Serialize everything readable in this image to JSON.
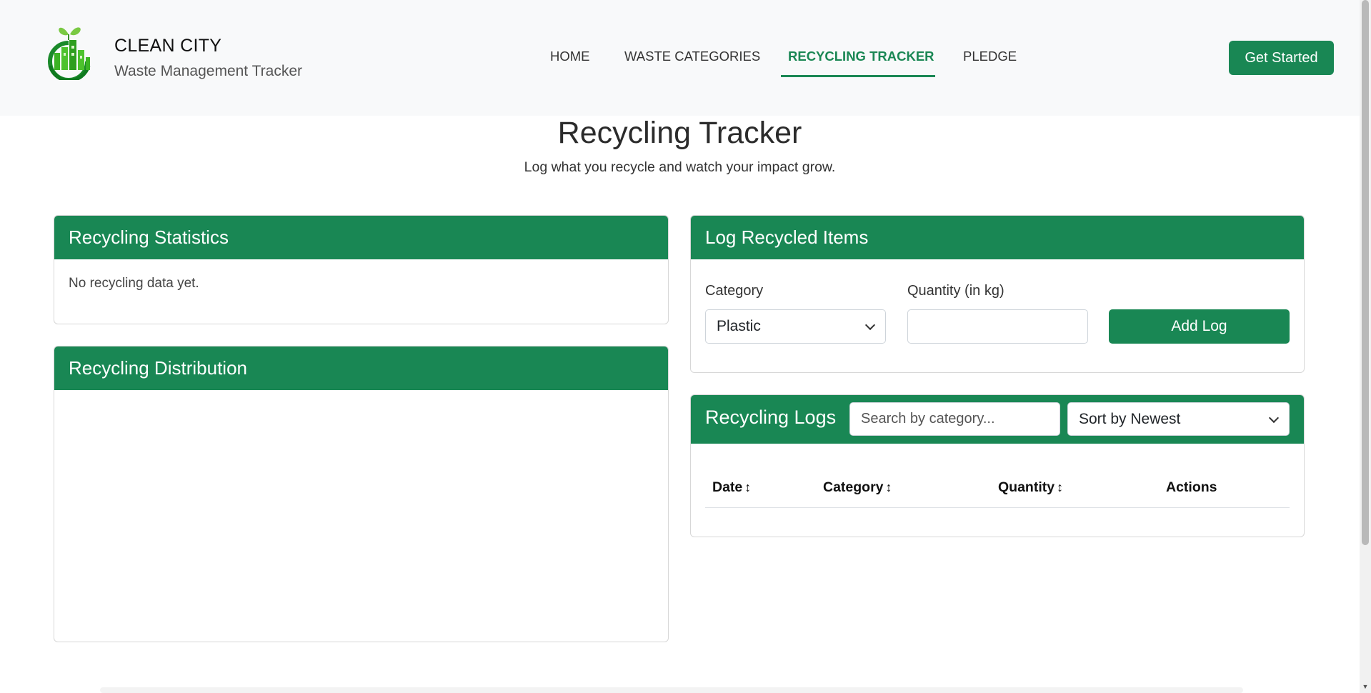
{
  "brand": {
    "name": "CLEAN CITY",
    "tagline": "Waste Management Tracker"
  },
  "nav": {
    "items": [
      {
        "label": "HOME",
        "active": false
      },
      {
        "label": "WASTE CATEGORIES",
        "active": false
      },
      {
        "label": "RECYCLING TRACKER",
        "active": true
      },
      {
        "label": "PLEDGE",
        "active": false
      }
    ],
    "cta_label": "Get Started"
  },
  "page": {
    "title": "Recycling Tracker",
    "subtitle": "Log what you recycle and watch your impact grow."
  },
  "stats": {
    "title": "Recycling Statistics",
    "empty_text": "No recycling data yet."
  },
  "distribution": {
    "title": "Recycling Distribution"
  },
  "log_form": {
    "title": "Log Recycled Items",
    "category_label": "Category",
    "category_value": "Plastic",
    "quantity_label": "Quantity (in kg)",
    "quantity_value": "",
    "submit_label": "Add Log"
  },
  "logs": {
    "title": "Recycling Logs",
    "search_placeholder": "Search by category...",
    "sort_value": "Sort by Newest",
    "columns": [
      {
        "label": "Date",
        "sortable": true
      },
      {
        "label": "Category",
        "sortable": true
      },
      {
        "label": "Quantity",
        "sortable": true
      },
      {
        "label": "Actions",
        "sortable": false
      }
    ],
    "sort_glyph": "↕"
  },
  "colors": {
    "primary": "#198754",
    "active_nav": "#1a8754",
    "header_bg": "#f8f9fa",
    "leaf": "#7ac943"
  },
  "icons": {
    "logo": "recycling-city-logo",
    "select": "chevron-down-icon",
    "sort": "sort-arrows-icon"
  }
}
